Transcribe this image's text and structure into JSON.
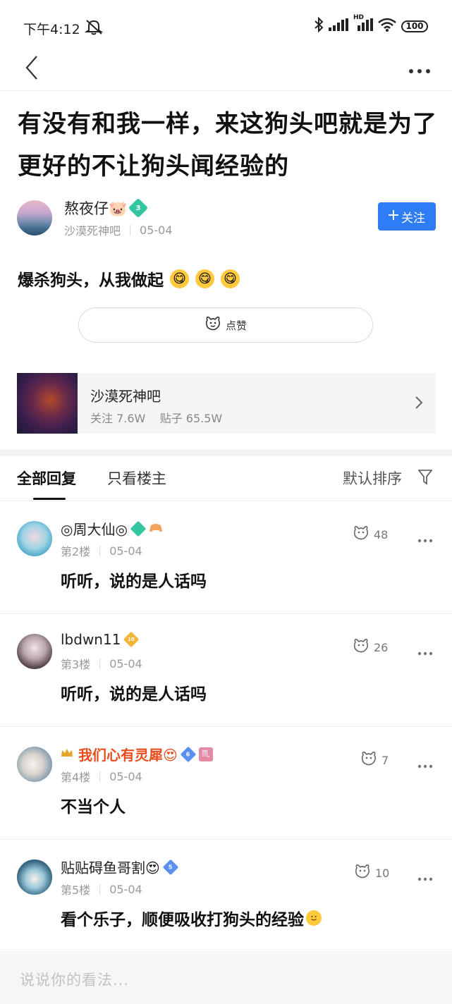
{
  "status_bar": {
    "time": "下午4:12",
    "battery": "100",
    "network_label": "HD"
  },
  "nav": {
    "back_icon": "chevron-left-icon",
    "more_icon": "more-dots-icon"
  },
  "post": {
    "title": "有没有和我一样，来这狗头吧就是为了更好的不让狗头闻经验的",
    "author": {
      "name": "熬夜仔🐷",
      "level": "3",
      "forum": "沙漠死神吧",
      "date": "05-04"
    },
    "follow_label": "关注",
    "body_text": "爆杀狗头，从我做起",
    "body_emojis": [
      "😋",
      "😋",
      "😋"
    ],
    "like_label": "点赞"
  },
  "forum_card": {
    "name": "沙漠死神吧",
    "stats": "关注 7.6W    贴子 65.5W"
  },
  "tabs": {
    "all": "全部回复",
    "op_only": "只看楼主",
    "sort": "默认排序"
  },
  "comments": [
    {
      "name": "◎周大仙◎",
      "floor": "第2楼",
      "date": "05-04",
      "text": "听听，说的是人话吗",
      "likes": "48"
    },
    {
      "name": "lbdwn11",
      "level": "10",
      "floor": "第3楼",
      "date": "05-04",
      "text": "听听，说的是人话吗",
      "likes": "26"
    },
    {
      "name": "我们心有灵犀😍",
      "level": "6",
      "floor": "第4楼",
      "date": "05-04",
      "text": "不当个人",
      "likes": "7"
    },
    {
      "name": "贴贴碍鱼哥割😍",
      "level": "5",
      "floor": "第5楼",
      "date": "05-04",
      "text": "看个乐子，顺便吸收打狗头的经验",
      "likes": "10"
    }
  ],
  "reply_bar": {
    "placeholder": "说说你的看法..."
  },
  "colors": {
    "accent": "#2f7df6",
    "vip_name": "#e74c1c",
    "badge_green": "#34c6a0"
  }
}
